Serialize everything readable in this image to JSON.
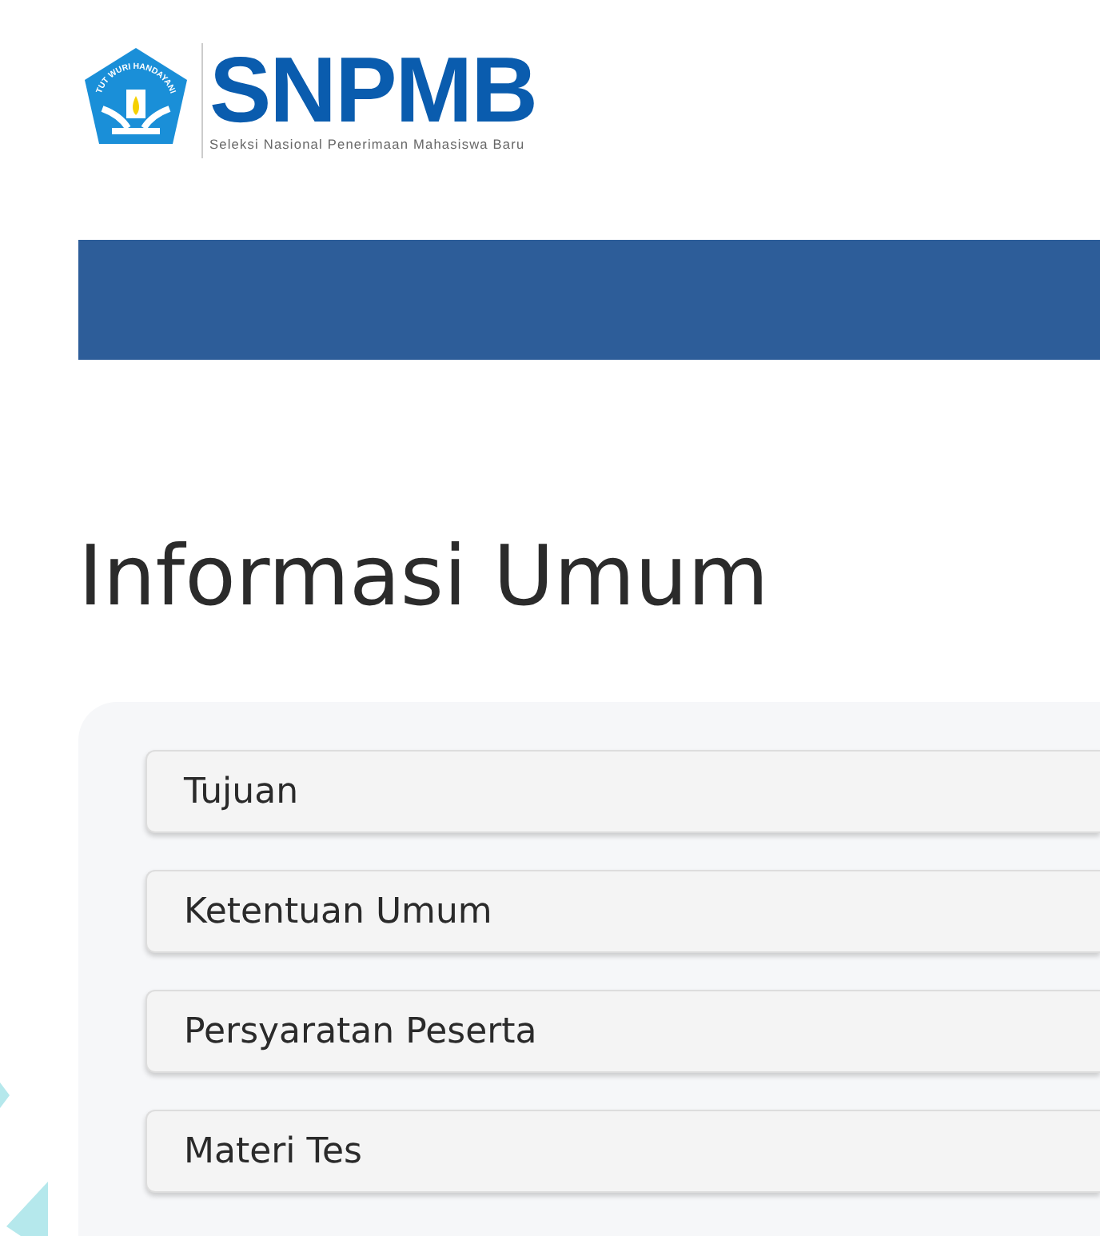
{
  "logo": {
    "emblem_text": "TUT WURI HANDAYANI",
    "name": "SNPMB",
    "subtitle": "Seleksi Nasional Penerimaan Mahasiswa Baru"
  },
  "title": "Informasi Umum",
  "accordion": [
    {
      "label": "Tujuan",
      "expanded": false
    },
    {
      "label": "Ketentuan Umum",
      "expanded": false
    },
    {
      "label": "Persyaratan Peserta",
      "expanded": false
    },
    {
      "label": "Materi Tes",
      "expanded": false
    }
  ]
}
